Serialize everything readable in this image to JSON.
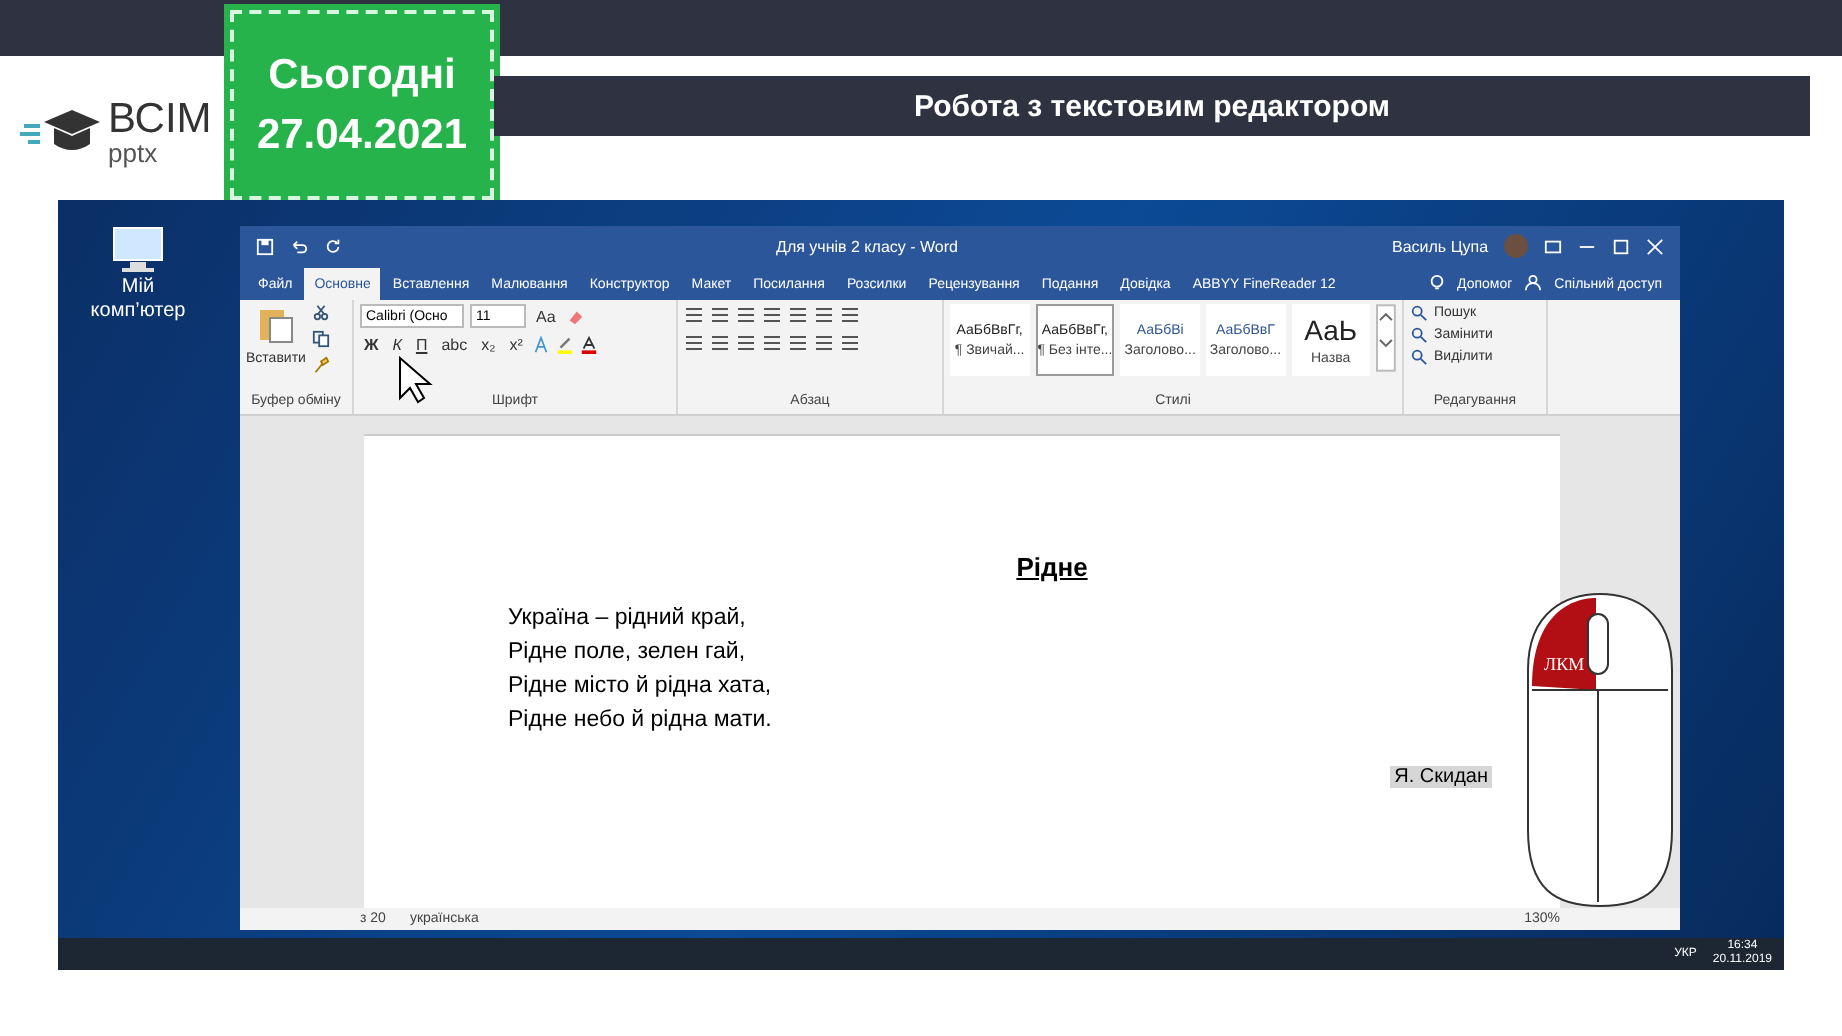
{
  "header": {
    "logo_text": "ВСІМ",
    "logo_sub": "pptx",
    "date_label": "Сьогодні",
    "date": "27.04.2021",
    "title": "Робота з текстовим редактором"
  },
  "desktop": {
    "icons": [
      {
        "label": "Мій комп’ютер"
      }
    ]
  },
  "word": {
    "title": "Для учнів 2 класу - Word",
    "user": "Василь Цупа",
    "tabs": [
      {
        "label": "Файл",
        "selected": false
      },
      {
        "label": "Основне",
        "selected": true
      },
      {
        "label": "Вставлення",
        "selected": false
      },
      {
        "label": "Малювання",
        "selected": false
      },
      {
        "label": "Конструктор",
        "selected": false
      },
      {
        "label": "Макет",
        "selected": false
      },
      {
        "label": "Посилання",
        "selected": false
      },
      {
        "label": "Розсилки",
        "selected": false
      },
      {
        "label": "Рецензування",
        "selected": false
      },
      {
        "label": "Подання",
        "selected": false
      },
      {
        "label": "Довідка",
        "selected": false
      },
      {
        "label": "ABBYY FineReader 12",
        "selected": false
      }
    ],
    "tell_me": "Допомог",
    "share": "Спільний доступ",
    "clipboard": {
      "paste": "Вставити",
      "group": "Буфер обміну"
    },
    "font": {
      "name": "Calibri (Осно",
      "size": "11",
      "case": "Аа",
      "buttons": [
        "Ж",
        "К",
        "П",
        "abc",
        "x₂",
        "x²"
      ],
      "group": "Шрифт"
    },
    "paragraph": {
      "group": "Абзац"
    },
    "styles": {
      "group": "Стилі",
      "items": [
        {
          "sample": "АаБбВвГг,",
          "name": "¶ Звичай...",
          "selected": false
        },
        {
          "sample": "АаБбВвГг,",
          "name": "¶ Без інте...",
          "selected": true
        },
        {
          "sample": "АаБбВі",
          "name": "Заголово...",
          "selected": false
        },
        {
          "sample": "АаБбВвГ",
          "name": "Заголово...",
          "selected": false
        },
        {
          "sample": "АаЬ",
          "name": "Назва",
          "selected": false
        }
      ]
    },
    "editing": {
      "group": "Редагування",
      "items": [
        "Пошук",
        "Замінити",
        "Виділити"
      ]
    },
    "document": {
      "heading": "Рідне",
      "lines": [
        "Україна – рідний край,",
        "Рідне поле, зелен гай,",
        "Рідне місто й рідна хата,",
        "Рідне небо й рідна мати."
      ],
      "author": "Я. Скидан"
    },
    "status": {
      "items": [
        "з 20",
        "українська"
      ],
      "zoom": "130%"
    }
  },
  "taskbar": {
    "lang": "УКР",
    "time": "16:34",
    "date": "20.11.2019"
  },
  "mouse": {
    "label": "ЛКМ"
  }
}
